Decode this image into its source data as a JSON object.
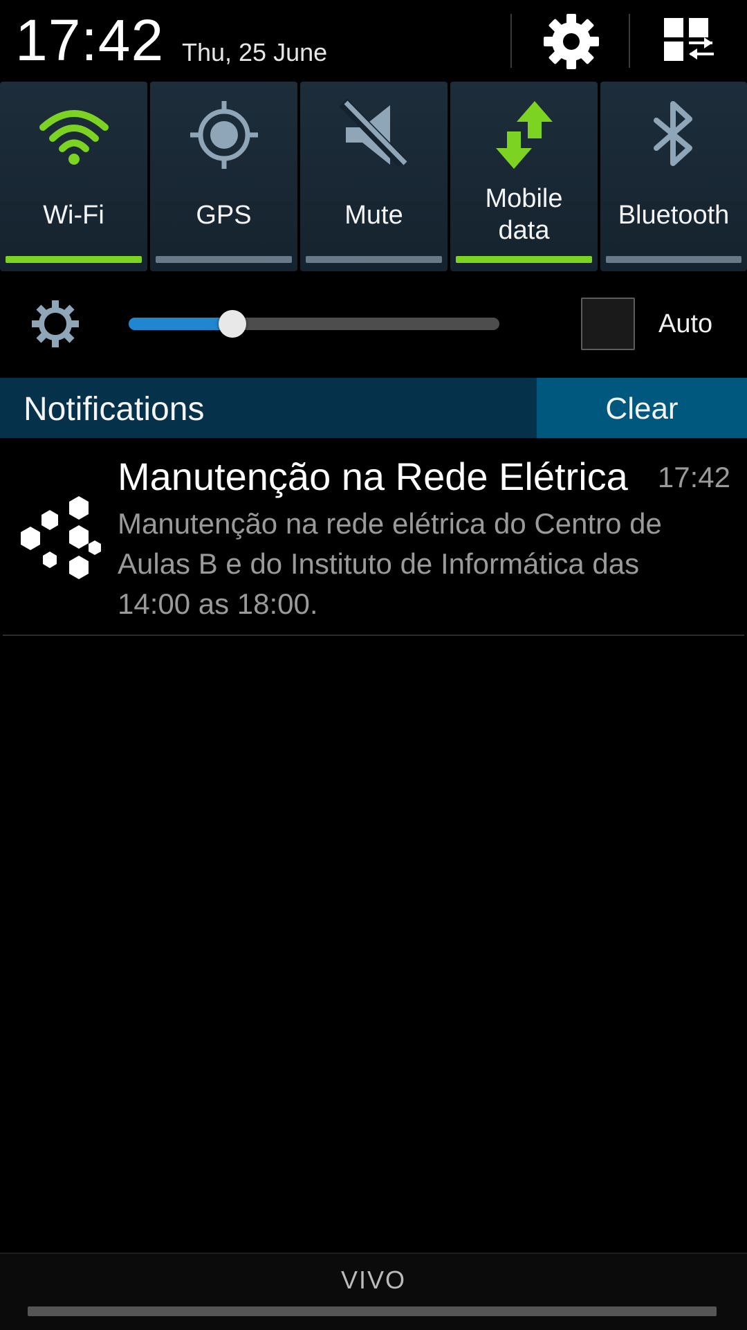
{
  "header": {
    "time": "17:42",
    "date": "Thu, 25 June",
    "settings_icon": "gear-icon",
    "edit_icon": "grid-edit-icon"
  },
  "toggles": [
    {
      "label": "Wi-Fi",
      "icon": "wifi-icon",
      "on": true
    },
    {
      "label": "GPS",
      "icon": "gps-icon",
      "on": false
    },
    {
      "label": "Mute",
      "icon": "mute-icon",
      "on": false
    },
    {
      "label_line1": "Mobile",
      "label_line2": "data",
      "icon": "mobile-data-icon",
      "on": true
    },
    {
      "label": "Bluetooth",
      "icon": "bluetooth-icon",
      "on": false
    }
  ],
  "brightness": {
    "level": 0.28,
    "auto_label": "Auto",
    "auto_checked": false
  },
  "notifications": {
    "title": "Notifications",
    "clear_label": "Clear",
    "items": [
      {
        "title": "Manutenção na Rede Elétrica",
        "time": "17:42",
        "body": "Manutenção na rede elétrica do Centro de Aulas B e do Instituto de Informática das 14:00 as 18:00.",
        "icon": "hexagon-cluster-icon"
      }
    ]
  },
  "footer": {
    "carrier": "VIVO"
  },
  "colors": {
    "toggle_on": "#7dd321",
    "toggle_off": "#667a89",
    "slider_fill": "#1f86cf",
    "notif_header_bg": "#05324a",
    "clear_bg": "#00587f"
  }
}
